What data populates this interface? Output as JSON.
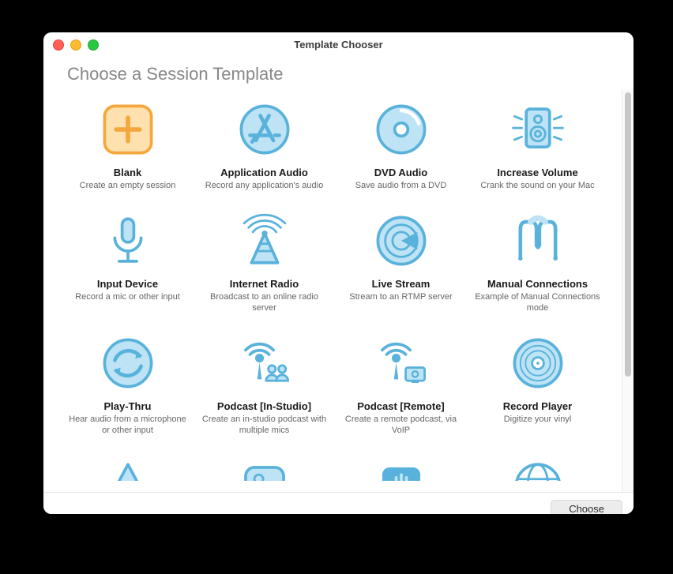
{
  "window": {
    "title": "Template Chooser"
  },
  "heading": "Choose a Session Template",
  "choose_label": "Choose",
  "templates": [
    {
      "icon": "plus-icon",
      "title": "Blank",
      "desc": "Create an empty session"
    },
    {
      "icon": "appstore-icon",
      "title": "Application Audio",
      "desc": "Record any application's audio"
    },
    {
      "icon": "disc-icon",
      "title": "DVD Audio",
      "desc": "Save audio from a DVD"
    },
    {
      "icon": "speaker-burst-icon",
      "title": "Increase Volume",
      "desc": "Crank the sound on your Mac"
    },
    {
      "icon": "microphone-icon",
      "title": "Input Device",
      "desc": "Record a mic or other input"
    },
    {
      "icon": "radio-tower-icon",
      "title": "Internet Radio",
      "desc": "Broadcast to an online radio server"
    },
    {
      "icon": "radar-icon",
      "title": "Live Stream",
      "desc": "Stream to an RTMP server"
    },
    {
      "icon": "manual-icon",
      "title": "Manual Connections",
      "desc": "Example of Manual Connections mode"
    },
    {
      "icon": "playthru-icon",
      "title": "Play-Thru",
      "desc": "Hear audio from a microphone or other input"
    },
    {
      "icon": "podcast-studio-icon",
      "title": "Podcast [In-Studio]",
      "desc": "Create an in-studio podcast with multiple mics"
    },
    {
      "icon": "podcast-remote-icon",
      "title": "Podcast [Remote]",
      "desc": "Create a remote podcast, via VoIP"
    },
    {
      "icon": "vinyl-icon",
      "title": "Record Player",
      "desc": "Digitize your vinyl"
    }
  ],
  "partial_icons": [
    "soundboard-icon",
    "system-audio-icon",
    "voice-chat-icon",
    "web-icon"
  ],
  "colors": {
    "stroke": "#59b2db",
    "fill": "#bde3f5",
    "blank_stroke": "#f3a73c",
    "blank_fill": "#ffe0af"
  }
}
